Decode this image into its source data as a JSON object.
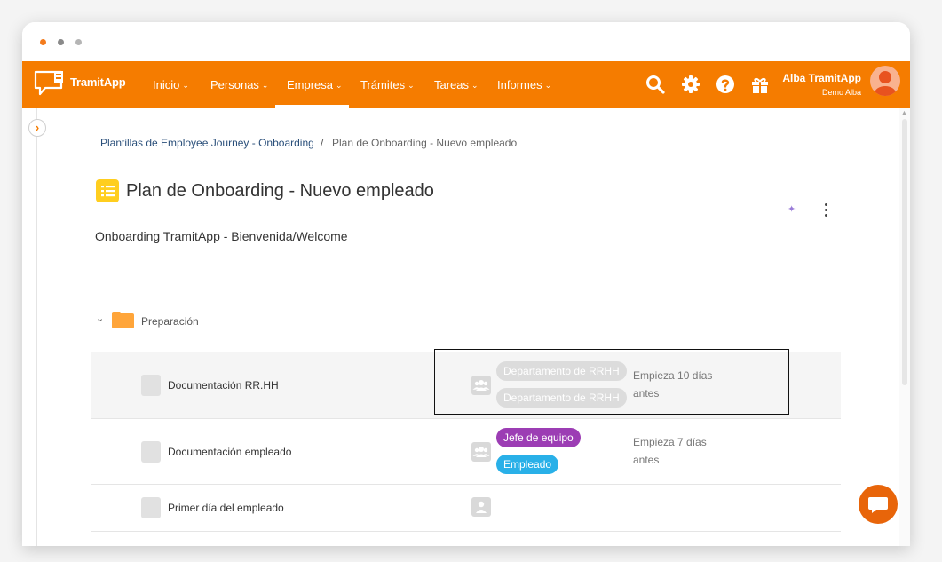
{
  "app": {
    "name": "TramitApp"
  },
  "nav": {
    "items": [
      {
        "label": "Inicio"
      },
      {
        "label": "Personas"
      },
      {
        "label": "Empresa",
        "active": true
      },
      {
        "label": "Trámites"
      },
      {
        "label": "Tareas"
      },
      {
        "label": "Informes"
      }
    ]
  },
  "user": {
    "name": "Alba TramitApp",
    "subtitle": "Demo Alba"
  },
  "breadcrumb": {
    "parent": "Plantillas de Employee Journey - Onboarding",
    "separator": "/",
    "current": "Plan de Onboarding - Nuevo empleado"
  },
  "page": {
    "title": "Plan de Onboarding - Nuevo empleado",
    "subtitle": "Onboarding TramitApp - Bienvenida/Welcome"
  },
  "section": {
    "label": "Preparación"
  },
  "tasks": [
    {
      "name": "Documentación RR.HH",
      "chips": [
        {
          "label": "Departamento de RRHH",
          "color": "grey"
        },
        {
          "label": "Departamento de RRHH",
          "color": "grey"
        }
      ],
      "starts": "Empieza 10 días antes"
    },
    {
      "name": "Documentación empleado",
      "chips": [
        {
          "label": "Jefe de equipo",
          "color": "purple"
        },
        {
          "label": "Empleado",
          "color": "blue"
        }
      ],
      "starts": "Empieza 7 días antes"
    },
    {
      "name": "Primer día del empleado",
      "chips": [],
      "starts": ""
    }
  ],
  "colors": {
    "brand": "#f57c00",
    "chip_grey": "#dcdcdc",
    "chip_purple": "#9c3db4",
    "chip_blue": "#29b0e8",
    "title_icon": "#ffce1f",
    "folder": "#ffa53a"
  },
  "icons": {
    "nav": [
      "search-icon",
      "gear-icon",
      "help-icon",
      "gift-icon"
    ],
    "title": "checklist-icon",
    "section": "folder-icon",
    "role_group": "group-icon",
    "role_person": "person-icon",
    "chat": "chat-icon"
  }
}
